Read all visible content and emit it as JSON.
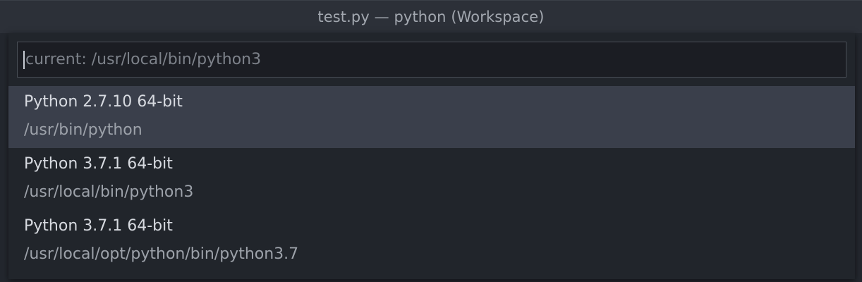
{
  "window": {
    "title": "test.py — python (Workspace)"
  },
  "quick_pick": {
    "placeholder": "current: /usr/local/bin/python3",
    "value": "",
    "items": [
      {
        "label": "Python 2.7.10 64-bit",
        "detail": "/usr/bin/python",
        "selected": true
      },
      {
        "label": "Python 3.7.1 64-bit",
        "detail": "/usr/local/bin/python3",
        "selected": false
      },
      {
        "label": "Python 3.7.1 64-bit",
        "detail": "/usr/local/opt/python/bin/python3.7",
        "selected": false
      }
    ]
  },
  "colors": {
    "background": "#23272e",
    "titlebar": "#2c3038",
    "selected_item": "#3a3f4b",
    "text_primary": "#d7dae0",
    "text_secondary": "#9da2aa"
  }
}
